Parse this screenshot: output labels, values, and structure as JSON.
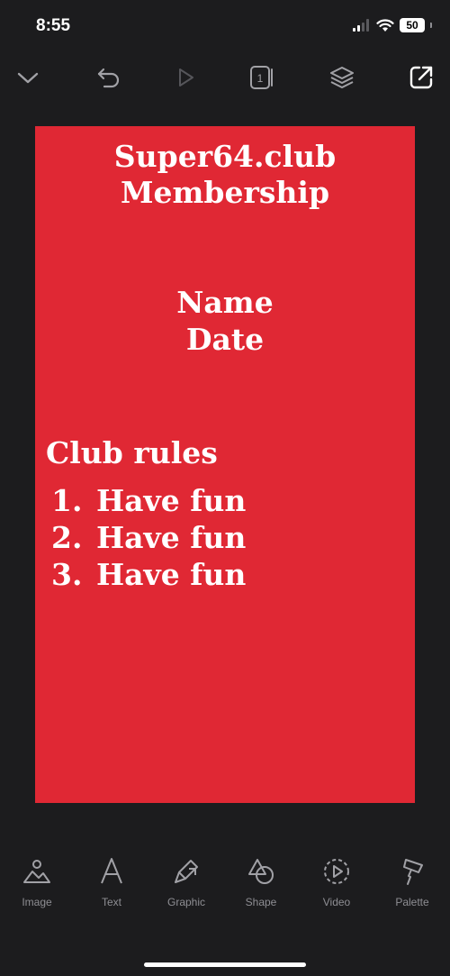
{
  "status_bar": {
    "time": "8:55",
    "battery": "50"
  },
  "toolbar": {
    "icons": [
      "chevron-down-icon",
      "undo-icon",
      "play-icon",
      "page-count-icon",
      "layers-icon",
      "share-icon"
    ],
    "page_count": "1"
  },
  "card": {
    "background": "#e02834",
    "title_line1": "Super64.club",
    "title_line2": "Membership",
    "name_label": "Name",
    "date_label": "Date",
    "rules_heading": "Club rules",
    "rules": [
      {
        "num": "1.",
        "text": "Have fun"
      },
      {
        "num": "2.",
        "text": "Have fun"
      },
      {
        "num": "3.",
        "text": "Have fun"
      }
    ]
  },
  "bottom_tools": [
    {
      "label": "Image",
      "icon": "image-icon"
    },
    {
      "label": "Text",
      "icon": "text-icon"
    },
    {
      "label": "Graphic",
      "icon": "graphic-icon"
    },
    {
      "label": "Shape",
      "icon": "shape-icon"
    },
    {
      "label": "Video",
      "icon": "video-icon"
    },
    {
      "label": "Palette",
      "icon": "palette-icon"
    }
  ]
}
